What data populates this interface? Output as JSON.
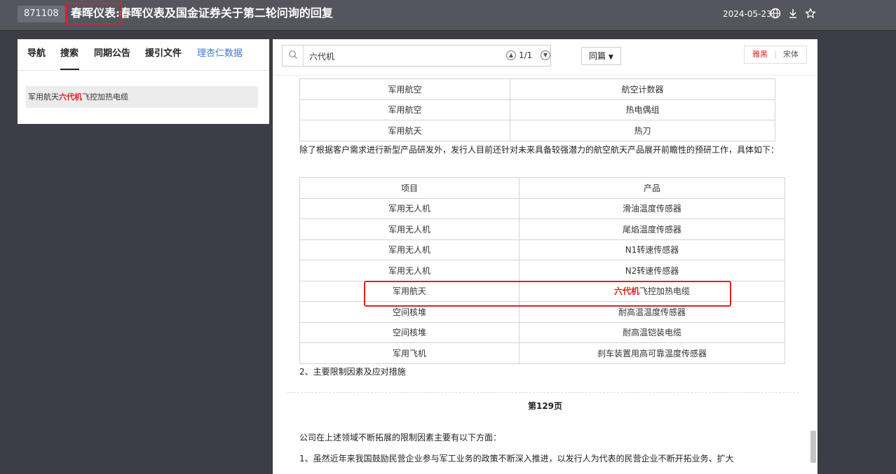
{
  "header": {
    "code": "871108",
    "title": "春晖仪表:春晖仪表及国金证券关于第二轮问询的回复",
    "date": "2024-05-23"
  },
  "icons": [
    "globe-icon",
    "download-icon",
    "star-icon",
    "search-icon",
    "chevron-up-icon",
    "chevron-down-icon"
  ],
  "colors": {
    "highlight": "#e02020",
    "link": "#3c78d8",
    "topbar": "#55555e",
    "background": "#3d3d45"
  },
  "left_panel": {
    "tabs": [
      {
        "label": "导航"
      },
      {
        "label": "搜索"
      },
      {
        "label": "同期公告"
      },
      {
        "label": "援引文件"
      },
      {
        "label": "理杏仁数据"
      }
    ],
    "active_tab": "搜索",
    "result": {
      "prefix": "军用航天",
      "highlight": "六代机",
      "suffix": "飞控加热电缆"
    }
  },
  "toolbar": {
    "search_value": "六代机",
    "match_count": "1/1",
    "scope_option": "同篇",
    "font_options": [
      "雅黑",
      "宋体"
    ],
    "active_font": "雅黑"
  },
  "document": {
    "table1": [
      [
        "军用航空",
        "航空计数器"
      ],
      [
        "军用航空",
        "热电偶组"
      ],
      [
        "军用航天",
        "热刀"
      ]
    ],
    "paragraph1": "除了根据客户需求进行新型产品研发外，发行人目前还针对未来具备较强潜力的航空航天产品展开前瞻性的预研工作，具体如下：",
    "table2_header": [
      "项目",
      "产品"
    ],
    "table2": [
      [
        "军用无人机",
        "滑油温度传感器"
      ],
      [
        "军用无人机",
        "尾焰温度传感器"
      ],
      [
        "军用无人机",
        "N1转速传感器"
      ],
      [
        "军用无人机",
        "N2转速传感器"
      ],
      [
        "军用航天",
        "六代机飞控加热电缆"
      ],
      [
        "空间核堆",
        "耐高温温度传感器"
      ],
      [
        "空间核堆",
        "耐高温铠装电缆"
      ],
      [
        "军用飞机",
        "刹车装置用高可靠温度传感器"
      ]
    ],
    "highlight_row": {
      "item": "军用航天",
      "keyword": "六代机",
      "rest": "飞控加热电缆"
    },
    "section_heading": "2、主要限制因素及应对措施",
    "page_label": "第129页",
    "paragraph2": "公司在上述领域不断拓展的限制因素主要有以下方面：",
    "paragraph3": "1、虽然近年来我国鼓励民营企业参与军工业务的政策不断深入推进，以发行人为代表的民营企业不断开拓业务、扩大"
  }
}
